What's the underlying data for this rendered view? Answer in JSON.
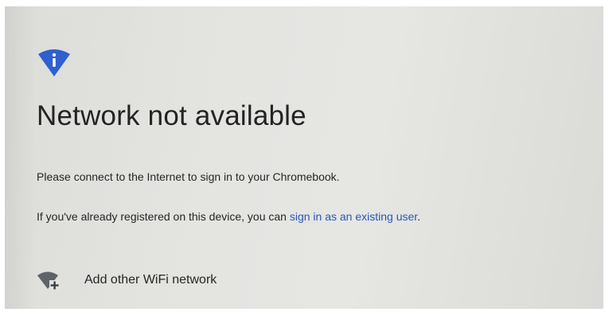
{
  "screen": {
    "title": "Network not available",
    "message_connect": "Please connect to the Internet to sign in to your Chromebook.",
    "message_registered_prefix": "If you've already registered on this device, you can ",
    "sign_in_link": "sign in as an existing user",
    "message_registered_suffix": ".",
    "add_network_label": "Add other WiFi network"
  },
  "icons": {
    "header": "wifi-info-icon",
    "add_network": "wifi-add-icon"
  },
  "colors": {
    "accent_blue": "#2f5fd0",
    "link_blue": "#2a56b8",
    "icon_gray": "#5f6368",
    "text_dark": "#232323"
  }
}
